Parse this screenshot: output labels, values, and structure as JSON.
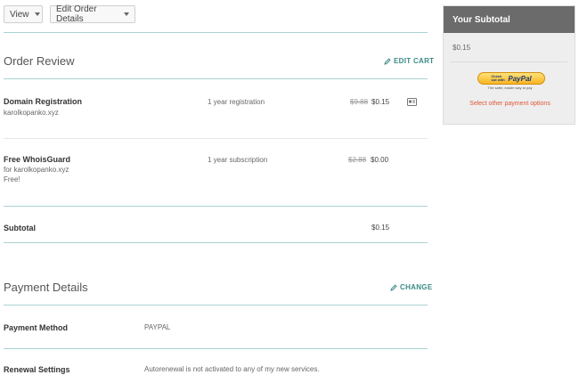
{
  "toolbar": {
    "view_label": "View",
    "edit_label": "Edit Order Details"
  },
  "order_review": {
    "title": "Order Review",
    "edit_cart": "EDIT CART",
    "items": [
      {
        "name": "Domain Registration",
        "detail": "karolkopanko.xyz",
        "term": "1 year registration",
        "old_price": "$9.88",
        "price": "$0.15"
      },
      {
        "name": "Free WhoisGuard",
        "detail": "for karolkopanko.xyz",
        "note": "Free!",
        "term": "1 year subscription",
        "old_price": "$2.88",
        "price": "$0.00"
      }
    ],
    "subtotal_label": "Subtotal",
    "subtotal_value": "$0.15"
  },
  "payment_details": {
    "title": "Payment Details",
    "change": "CHANGE",
    "method_label": "Payment Method",
    "method_value": "PAYPAL",
    "renewal_label": "Renewal Settings",
    "renewal_value": "Autorenewal is not activated to any of my new services."
  },
  "sidebar": {
    "title": "Your Subtotal",
    "amount": "$0.15",
    "paypal_checkout": "Check out with",
    "paypal_brand": "PayPal",
    "paypal_tagline": "The safer, easier way to pay",
    "other_options": "Select other payment options"
  },
  "colors": {
    "accent": "#3a8a86",
    "link_red": "#e2543a",
    "divider": "#a8d3d1"
  }
}
